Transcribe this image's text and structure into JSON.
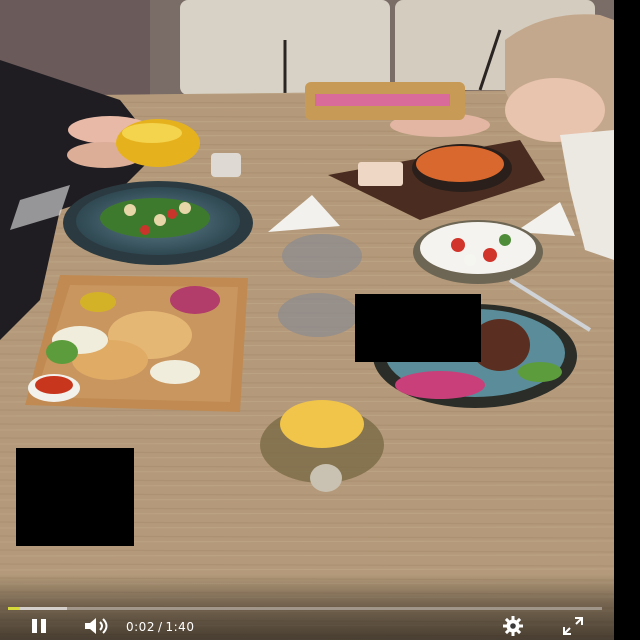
{
  "player": {
    "time": {
      "current": "0:02",
      "separator": "/",
      "duration": "1:40"
    },
    "progress": {
      "played_fraction": 0.02,
      "buffered_fraction": 0.1
    },
    "colors": {
      "played": "#d6d93a",
      "icons": "#ffffff"
    },
    "controls": {
      "play_pause": "pause-icon",
      "volume": "volume-icon",
      "settings": "gear-icon",
      "fullscreen": "fullscreen-icon"
    }
  }
}
